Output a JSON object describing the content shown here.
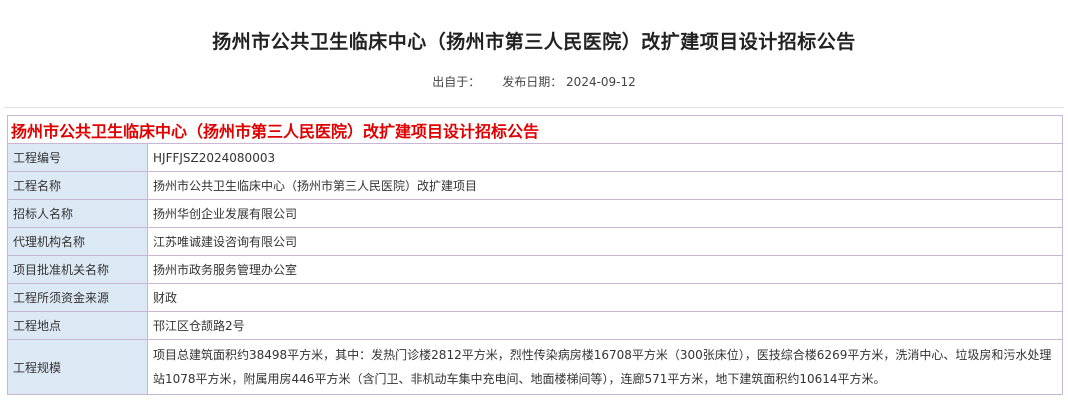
{
  "page": {
    "title": "扬州市公共卫生临床中心（扬州市第三人民医院）改扩建项目设计招标公告",
    "source_label": "出自于：",
    "date_label": "发布日期：",
    "date_value": "2024-09-12"
  },
  "table": {
    "header": "扬州市公共卫生临床中心（扬州市第三人民医院）改扩建项目设计招标公告",
    "rows": [
      {
        "label": "工程编号",
        "value": "HJFFJSZ2024080003"
      },
      {
        "label": "工程名称",
        "value": "扬州市公共卫生临床中心（扬州市第三人民医院）改扩建项目"
      },
      {
        "label": "招标人名称",
        "value": "扬州华创企业发展有限公司"
      },
      {
        "label": "代理机构名称",
        "value": "江苏唯诚建设咨询有限公司"
      },
      {
        "label": "项目批准机关名称",
        "value": "扬州市政务服务管理办公室"
      },
      {
        "label": "工程所须资金来源",
        "value": "财政"
      },
      {
        "label": "工程地点",
        "value": "邗江区仓颉路2号"
      },
      {
        "label": "工程规模",
        "value": "项目总建筑面积约38498平方米，其中：发热门诊楼2812平方米，烈性传染病房楼16708平方米（300张床位），医技综合楼6269平方米，洗消中心、垃圾房和污水处理站1078平方米，附属用房446平方米（含门卫、非机动车集中充电间、地面楼梯间等），连廊571平方米，地下建筑面积约10614平方米。"
      }
    ]
  }
}
